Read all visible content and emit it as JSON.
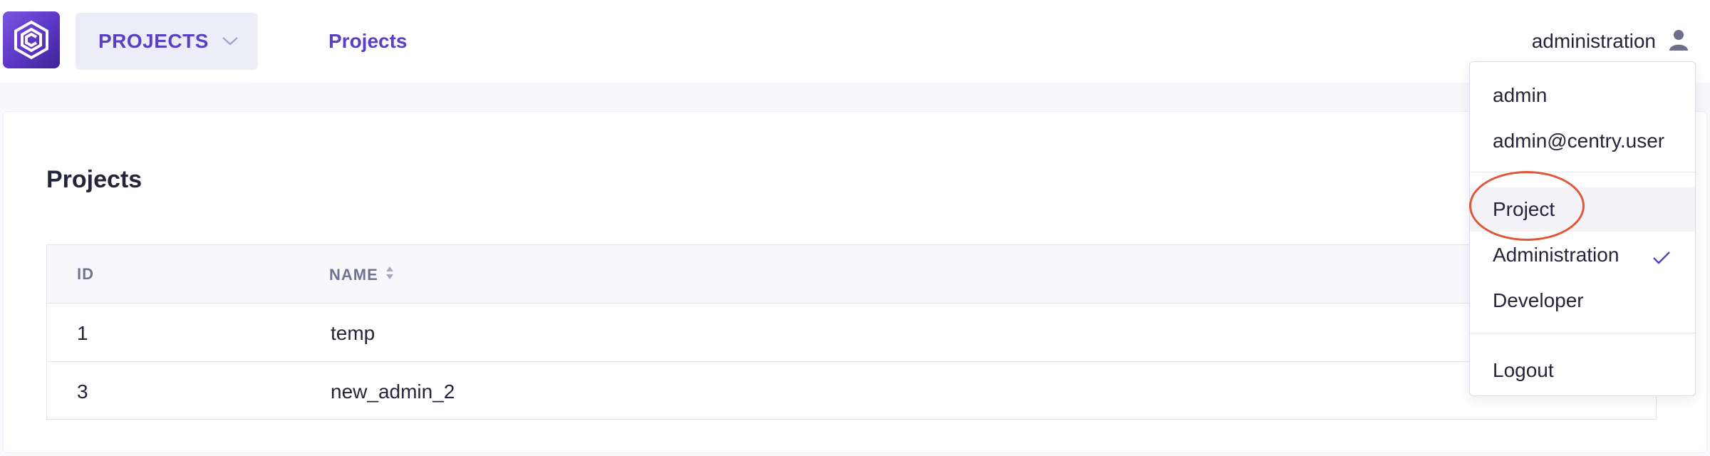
{
  "header": {
    "app_switcher_label": "PROJECTS",
    "nav_link": "Projects",
    "user_name": "administration"
  },
  "page": {
    "title": "Projects"
  },
  "table": {
    "columns": [
      "ID",
      "NAME"
    ],
    "rows": [
      {
        "id": "1",
        "name": "temp"
      },
      {
        "id": "3",
        "name": "new_admin_2"
      }
    ]
  },
  "user_menu": {
    "username": "admin",
    "email": "admin@centry.user",
    "modes": [
      "Project",
      "Administration",
      "Developer"
    ],
    "selected_mode": "Administration",
    "logout": "Logout"
  },
  "colors": {
    "accent": "#5a3ec4",
    "highlight_circle": "#e05638"
  },
  "icons": {
    "logo": "centry-logo-icon",
    "dropdown": "chevron-down-icon",
    "user": "user-icon",
    "sort": "sort-icon",
    "check": "check-icon"
  }
}
